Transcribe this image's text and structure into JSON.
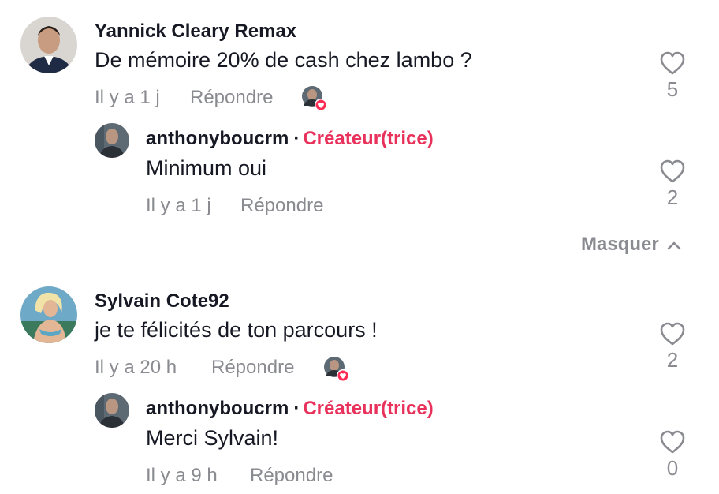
{
  "comments": [
    {
      "author": "Yannick Cleary Remax",
      "text": "De mémoire 20% de cash chez lambo ?",
      "time": "Il y a 1 j",
      "reply_label": "Répondre",
      "likes": "5",
      "reply": {
        "author": "anthonyboucrm",
        "separator": "·",
        "badge": "Créateur(trice)",
        "text": "Minimum oui",
        "time": "Il y a 1 j",
        "reply_label": "Répondre",
        "likes": "2"
      }
    },
    {
      "author": "Sylvain Cote92",
      "text": "je te félicités de ton parcours !",
      "time": "Il y a 20 h",
      "reply_label": "Répondre",
      "likes": "2",
      "reply": {
        "author": "anthonyboucrm",
        "separator": "·",
        "badge": "Créateur(trice)",
        "text": "Merci Sylvain!",
        "time": "Il y a 9 h",
        "reply_label": "Répondre",
        "likes": "0"
      }
    }
  ],
  "hide_replies_label": "Masquer",
  "colors": {
    "creator_badge": "#e8325c",
    "muted_text": "#8a8b91",
    "primary_text": "#161823",
    "heart_badge": "#fe2c55"
  },
  "icons": {
    "like": "heart-outline-icon",
    "liked_by_creator": "creator-liked-heart-icon",
    "collapse": "chevron-up-icon"
  }
}
